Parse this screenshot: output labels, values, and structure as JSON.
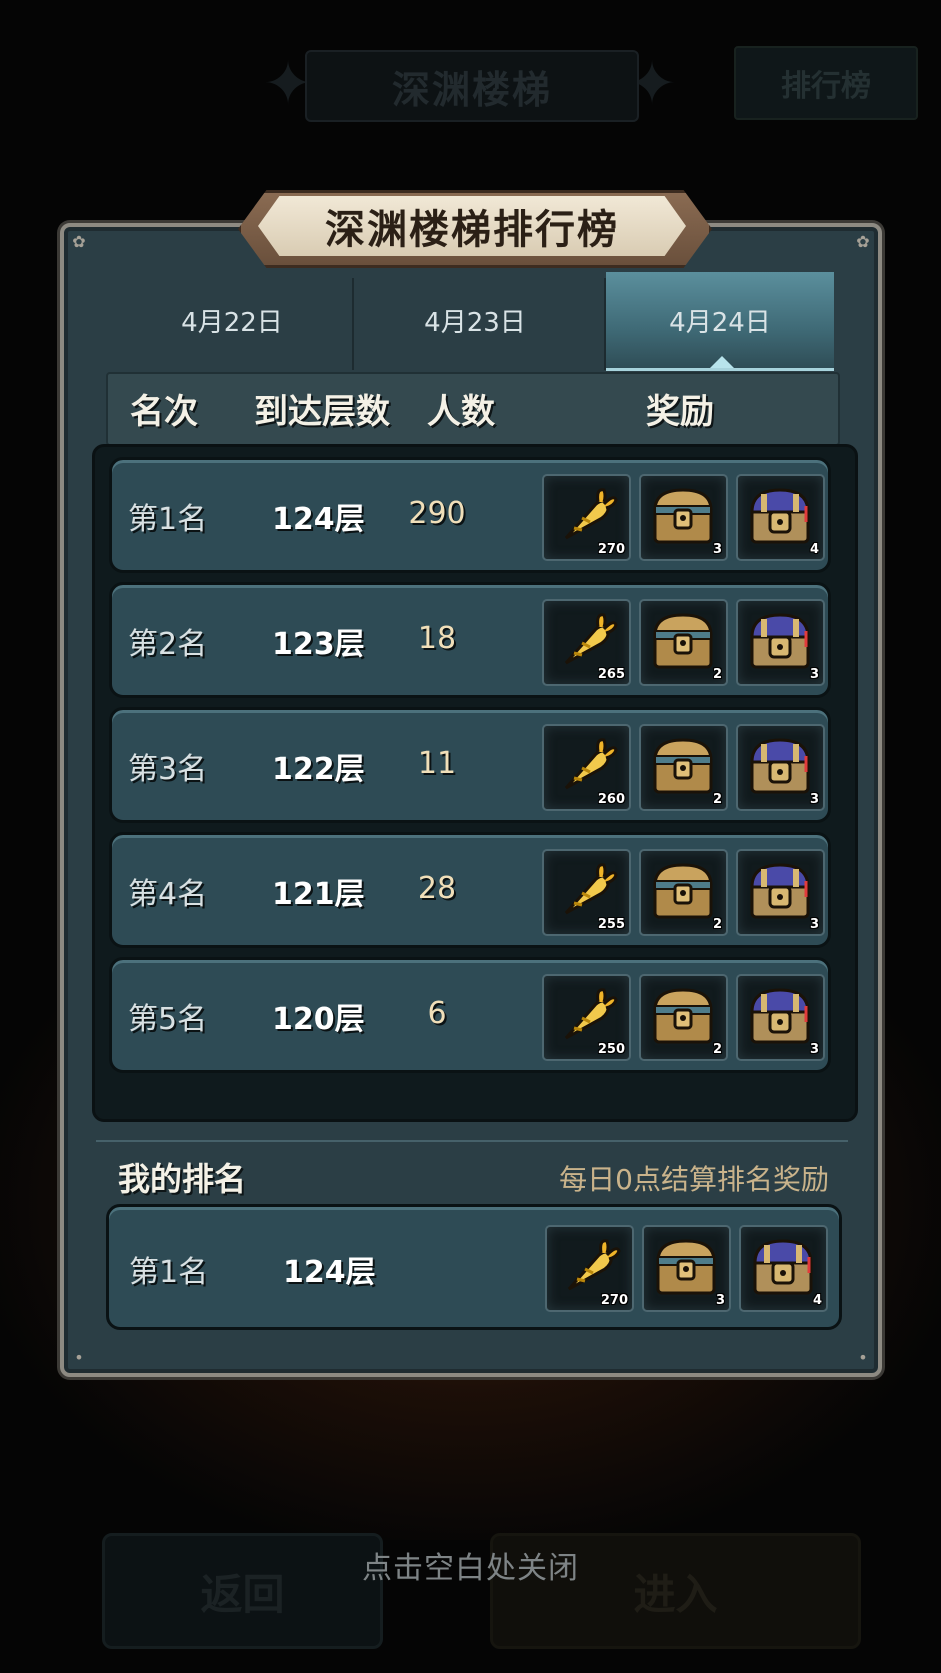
{
  "background": {
    "title": "深渊楼梯",
    "leaderboard_button": "排行榜",
    "back_button": "返回",
    "enter_button": "进入"
  },
  "close_hint": "点击空白处关闭",
  "dialog": {
    "title": "深渊楼梯排行榜",
    "tabs": [
      {
        "label": "4月22日",
        "selected": false
      },
      {
        "label": "4月23日",
        "selected": false
      },
      {
        "label": "4月24日",
        "selected": true
      }
    ],
    "headers": {
      "rank": "名次",
      "floor": "到达层数",
      "count": "人数",
      "reward": "奖励"
    },
    "rows": [
      {
        "rank": "第1名",
        "floor": "124层",
        "count": "290",
        "rewards": [
          "270",
          "3",
          "4"
        ]
      },
      {
        "rank": "第2名",
        "floor": "123层",
        "count": "18",
        "rewards": [
          "265",
          "2",
          "3"
        ]
      },
      {
        "rank": "第3名",
        "floor": "122层",
        "count": "11",
        "rewards": [
          "260",
          "2",
          "3"
        ]
      },
      {
        "rank": "第4名",
        "floor": "121层",
        "count": "28",
        "rewards": [
          "255",
          "2",
          "3"
        ]
      },
      {
        "rank": "第5名",
        "floor": "120层",
        "count": "6",
        "rewards": [
          "250",
          "2",
          "3"
        ]
      }
    ],
    "reward_icons": [
      "golden-carrot-icon",
      "blue-treasure-chest-icon",
      "purple-treasure-chest-icon"
    ],
    "my_rank": {
      "label": "我的排名",
      "note": "每日0点结算排名奖励",
      "rank": "第1名",
      "floor": "124层",
      "rewards": [
        "270",
        "3",
        "4"
      ]
    }
  },
  "colors": {
    "panel": "#2b3e45",
    "row": "#2e4b55",
    "selected_tab": "#5b8f9d",
    "title_banner": "#e6dcc6"
  }
}
